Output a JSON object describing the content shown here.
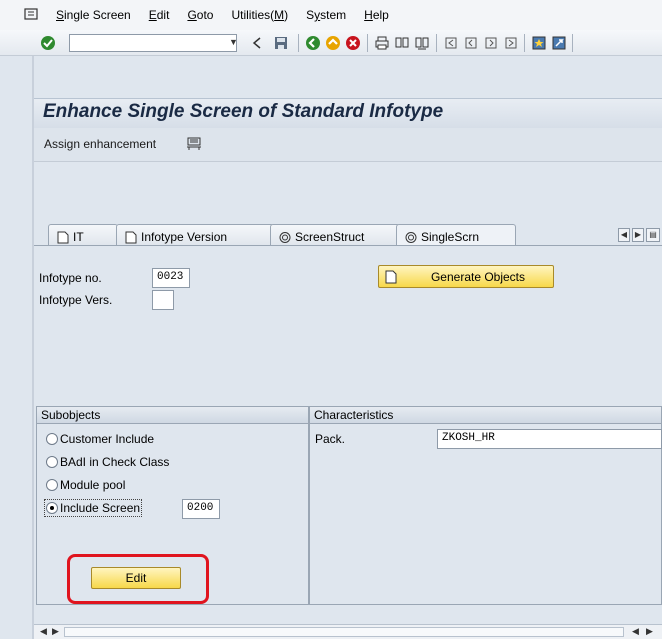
{
  "menu": {
    "items": [
      {
        "label": "Single Screen",
        "underline": "S"
      },
      {
        "label": "Edit",
        "underline": "E"
      },
      {
        "label": "Goto",
        "underline": "G"
      },
      {
        "label": "Utilities(M)",
        "underline": "M"
      },
      {
        "label": "System",
        "underline": "y"
      },
      {
        "label": "Help",
        "underline": "H"
      }
    ]
  },
  "toolbar": {
    "command_field_value": "",
    "icons": [
      "enter-icon",
      "back-nav-icon",
      "save-icon",
      "back-icon",
      "exit-icon",
      "cancel-icon",
      "print-icon",
      "find-icon",
      "find-next-icon",
      "first-page-icon",
      "previous-page-icon",
      "next-page-icon",
      "last-page-icon",
      "create-session-icon",
      "shortcut-icon"
    ]
  },
  "title": "Enhance Single Screen of Standard Infotype",
  "app_toolbar": {
    "assign_label": "Assign enhancement"
  },
  "tabs": [
    {
      "label": "IT",
      "icon": "document-icon"
    },
    {
      "label": "Infotype Version",
      "icon": "document-icon"
    },
    {
      "label": "ScreenStruct",
      "icon": "spiral-icon"
    },
    {
      "label": "SingleScrn",
      "icon": "spiral-icon",
      "active": true
    }
  ],
  "form": {
    "infotype_no_label": "Infotype no.",
    "infotype_no_value": "0023",
    "infotype_vers_label": "Infotype Vers.",
    "infotype_vers_value": "",
    "generate_button": "Generate Objects"
  },
  "subobjects": {
    "header": "Subobjects",
    "options": [
      {
        "label": "Customer Include",
        "selected": false
      },
      {
        "label": "BAdI in Check Class",
        "selected": false
      },
      {
        "label": "Module pool",
        "selected": false
      },
      {
        "label": "Include Screen",
        "selected": true
      }
    ],
    "include_screen_value": "0200",
    "edit_button": "Edit"
  },
  "characteristics": {
    "header": "Characteristics",
    "pack_label": "Pack.",
    "pack_value": "ZKOSH_HR"
  },
  "colors": {
    "button_yellow": "#f7d84a",
    "highlight_red": "#e0141e",
    "title_text": "#1a2a44"
  }
}
